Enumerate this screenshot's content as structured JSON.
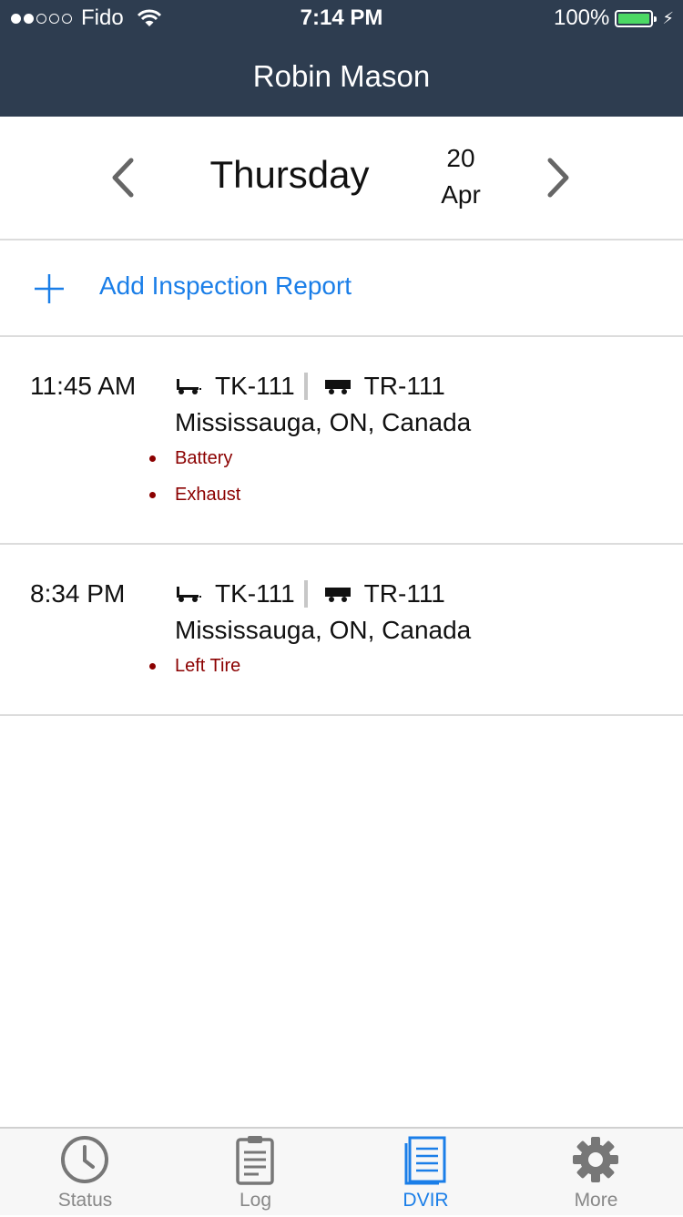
{
  "status_bar": {
    "carrier": "Fido",
    "time": "7:14 PM",
    "battery": "100%"
  },
  "nav": {
    "title": "Robin Mason"
  },
  "date_selector": {
    "day_name": "Thursday",
    "day_number": "20",
    "month": "Apr"
  },
  "add_report": {
    "label": "Add Inspection Report"
  },
  "reports": [
    {
      "time": "11:45 AM",
      "truck": "TK-111",
      "trailer": "TR-111",
      "location": "Mississauga, ON, Canada",
      "defects": [
        "Battery",
        "Exhaust"
      ]
    },
    {
      "time": "8:34 PM",
      "truck": "TK-111",
      "trailer": "TR-111",
      "location": "Mississauga, ON, Canada",
      "defects": [
        "Left Tire"
      ]
    }
  ],
  "tabs": [
    {
      "label": "Status",
      "icon": "clock-icon",
      "active": false
    },
    {
      "label": "Log",
      "icon": "clipboard-icon",
      "active": false
    },
    {
      "label": "DVIR",
      "icon": "document-icon",
      "active": true
    },
    {
      "label": "More",
      "icon": "gear-icon",
      "active": false
    }
  ],
  "colors": {
    "nav_bg": "#2e3d50",
    "accent": "#1a7ee8",
    "defect": "#8b0000",
    "battery": "#4cd964"
  }
}
